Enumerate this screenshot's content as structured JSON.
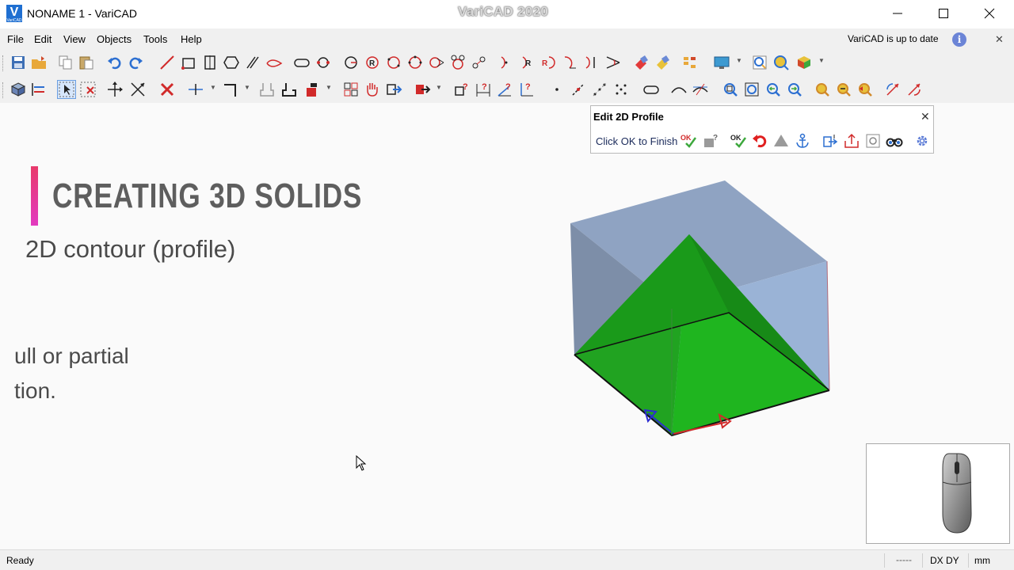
{
  "window": {
    "title": "NONAME 1 - VariCAD",
    "logo_letter": "V",
    "logo_sub": "VariCAD",
    "watermark": "VariCAD 2020"
  },
  "menu": {
    "items": [
      "File",
      "Edit",
      "View",
      "Objects",
      "Tools",
      "Help"
    ],
    "update_notice": "VariCAD is up to date",
    "info_glyph": "i"
  },
  "profile_panel": {
    "title": "Edit 2D Profile",
    "hint": "Click OK to Finish",
    "ok_label": "OK"
  },
  "slide": {
    "title": "CREATING 3D SOLIDS",
    "subtitle": "2D contour (profile)",
    "body_line1": "ull or partial",
    "body_line2": "tion."
  },
  "status": {
    "state": "Ready",
    "coords": "-----",
    "coord_mode": "DX DY",
    "units": "mm"
  },
  "colors": {
    "accent_blue": "#1f6fd1",
    "solid_green": "#1fb51f",
    "box_blue": "#8fa7c9",
    "title_gray": "#5e5e5e"
  }
}
